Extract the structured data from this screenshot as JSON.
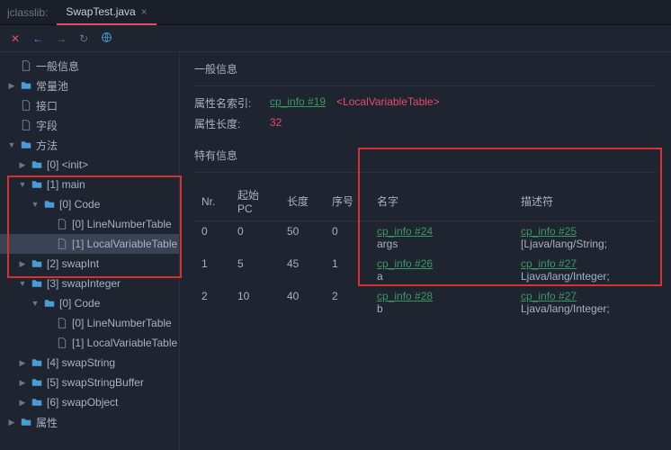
{
  "tabprefix": "jclasslib:",
  "tab": {
    "label": "SwapTest.java"
  },
  "sidebar": {
    "n0": "一般信息",
    "n1": "常量池",
    "n2": "接口",
    "n3": "字段",
    "n4": "方法",
    "m0": "[0] <init>",
    "m1": "[1] main",
    "m1c": "[0] Code",
    "m1c0": "[0] LineNumberTable",
    "m1c1": "[1] LocalVariableTable",
    "m2": "[2] swapInt",
    "m3": "[3] swapInteger",
    "m3c": "[0] Code",
    "m3c0": "[0] LineNumberTable",
    "m3c1": "[1] LocalVariableTable",
    "m4": "[4] swapString",
    "m5": "[5] swapStringBuffer",
    "m6": "[6] swapObject",
    "n5": "属性"
  },
  "content": {
    "sec1": "一般信息",
    "attrIdxLabel": "属性名索引:",
    "attrIdxLink": "cp_info #19",
    "attrIdxTag": "<LocalVariableTable>",
    "attrLenLabel": "属性长度:",
    "attrLenVal": "32",
    "sec2": "特有信息"
  },
  "table": {
    "h0": "Nr.",
    "h1": "起始PC",
    "h2": "长度",
    "h3": "序号",
    "h4": "名字",
    "h5": "描述符",
    "rows": [
      {
        "nr": "0",
        "pc": "0",
        "len": "50",
        "idx": "0",
        "nameLink": "cp_info #24",
        "nameSub": "args",
        "descLink": "cp_info #25",
        "descSub": "[Ljava/lang/String;"
      },
      {
        "nr": "1",
        "pc": "5",
        "len": "45",
        "idx": "1",
        "nameLink": "cp_info #26",
        "nameSub": "a",
        "descLink": "cp_info #27",
        "descSub": "Ljava/lang/Integer;"
      },
      {
        "nr": "2",
        "pc": "10",
        "len": "40",
        "idx": "2",
        "nameLink": "cp_info #28",
        "nameSub": "b",
        "descLink": "cp_info #27",
        "descSub": "Ljava/lang/Integer;"
      }
    ]
  }
}
